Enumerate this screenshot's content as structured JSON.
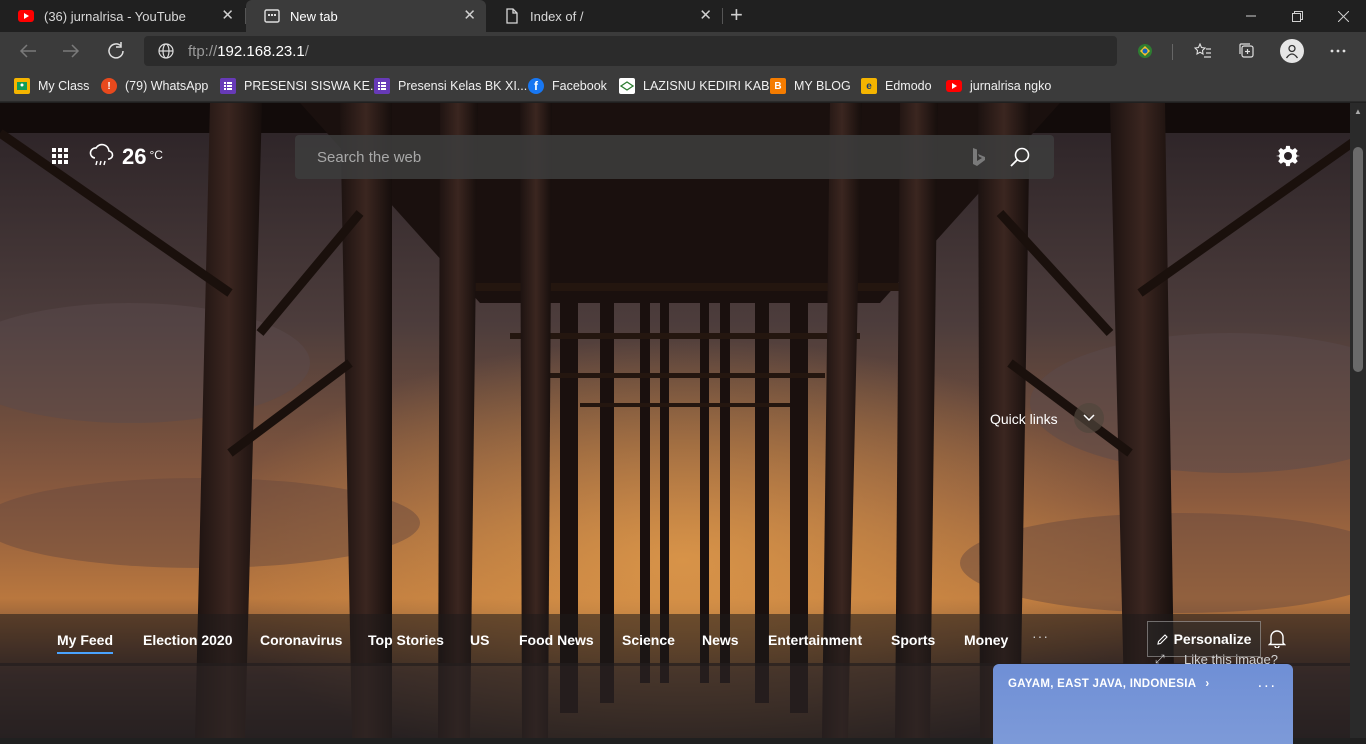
{
  "tabs": [
    {
      "title": "(36) jurnalrisa - YouTube",
      "icon": "youtube-icon"
    },
    {
      "title": "New tab",
      "icon": "new-tab-page-icon"
    },
    {
      "title": "Index of /",
      "icon": "document-icon"
    }
  ],
  "address_bar": {
    "scheme": "ftp://",
    "host": "192.168.23.1",
    "path": "/"
  },
  "bookmarks": [
    {
      "label": "My Class",
      "icon": "classroom-icon",
      "color": "#f4b400"
    },
    {
      "label": "(79) WhatsApp",
      "icon": "alert-icon",
      "color": "#e8491d"
    },
    {
      "label": "PRESENSI SISWA KE...",
      "icon": "form-icon",
      "color": "#673ab7"
    },
    {
      "label": "Presensi Kelas BK XI...",
      "icon": "form-icon",
      "color": "#673ab7"
    },
    {
      "label": "Facebook",
      "icon": "facebook-icon",
      "color": "#1877f2"
    },
    {
      "label": "LAZISNU KEDIRI KAB",
      "icon": "site-icon",
      "color": "#2e7d32"
    },
    {
      "label": "MY BLOG",
      "icon": "blogger-icon",
      "color": "#f57c00"
    },
    {
      "label": "Edmodo",
      "icon": "edmodo-icon",
      "color": "#f4b400"
    },
    {
      "label": "jurnalrisa ngko",
      "icon": "youtube-icon",
      "color": "#ff0000"
    }
  ],
  "weather": {
    "temp": "26",
    "unit": "°C",
    "icon": "rain-cloud-icon"
  },
  "search": {
    "placeholder": "Search the web"
  },
  "quick_links": {
    "label": "Quick links"
  },
  "feed_tabs": [
    "My Feed",
    "Election 2020",
    "Coronavirus",
    "Top Stories",
    "US",
    "Food News",
    "Science",
    "News",
    "Entertainment",
    "Sports",
    "Money"
  ],
  "feed_more": "···",
  "personalize": {
    "label": "Personalize"
  },
  "like_image": "Like this image?",
  "location": {
    "label": "GAYAM, EAST JAVA, INDONESIA",
    "more": "..."
  }
}
